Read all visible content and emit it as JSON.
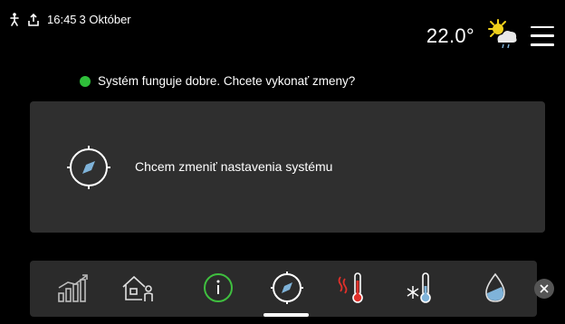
{
  "status_bar": {
    "time": "16:45",
    "date": "3 Október",
    "temperature": "22.0°",
    "icons": [
      "person-icon",
      "usb-icon",
      "partly-cloudy-icon",
      "menu-icon"
    ]
  },
  "system_status": {
    "message": "Systém funguje dobre. Chcete vykonať zmeny?",
    "indicator_color": "#2fbf3a"
  },
  "main_card": {
    "label": "Chcem zmeniť nastavenia systému",
    "icon": "compass-icon"
  },
  "bottom_nav": {
    "items": [
      {
        "icon": "statistics-icon"
      },
      {
        "icon": "home-person-icon"
      },
      {
        "icon": "info-icon"
      },
      {
        "icon": "compass-icon",
        "active": true
      },
      {
        "icon": "heating-thermometer-icon"
      },
      {
        "icon": "cooling-thermometer-icon"
      },
      {
        "icon": "water-drop-icon"
      }
    ],
    "close_icon": "close-icon"
  },
  "colors": {
    "background": "#000000",
    "card": "#2f2f2f",
    "bar": "#2b2b2b",
    "accent_green": "#2fbf3a",
    "heat_red": "#e0302a",
    "sun_yellow": "#f2d21b",
    "water_blue": "#7fb3d9"
  }
}
